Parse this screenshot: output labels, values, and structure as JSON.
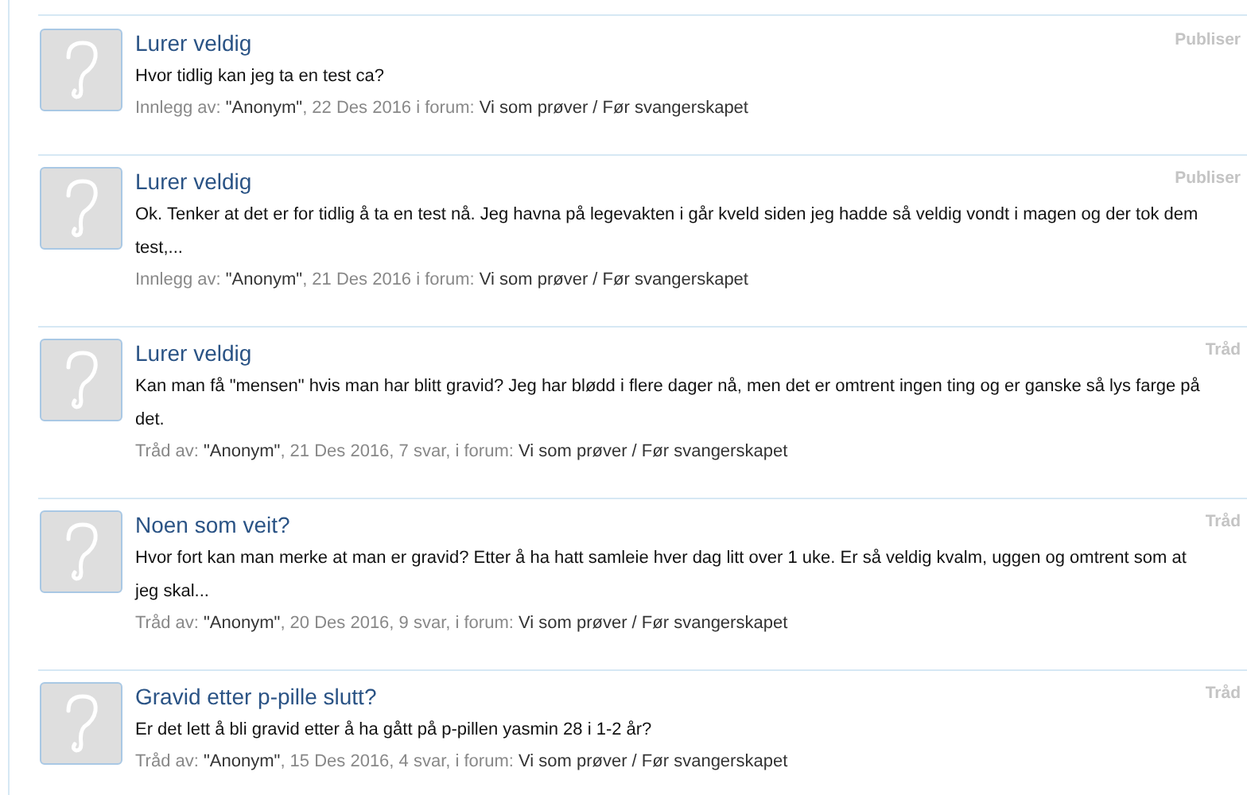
{
  "posts": [
    {
      "title": "Lurer veldig",
      "type": "Publiser",
      "body": "Hvor tidlig kan jeg ta en test ca?",
      "meta": {
        "label": "Innlegg av:",
        "author": "\"Anonym\"",
        "details": ", 22 Des 2016 i forum:",
        "forum": "Vi som prøver / Før svangerskapet"
      }
    },
    {
      "title": "Lurer veldig",
      "type": "Publiser",
      "body": "Ok. Tenker at det er for tidlig å ta en test nå. Jeg havna på legevakten i går kveld siden jeg hadde så veldig vondt i magen og der tok dem test,...",
      "meta": {
        "label": "Innlegg av:",
        "author": "\"Anonym\"",
        "details": ", 21 Des 2016 i forum:",
        "forum": "Vi som prøver / Før svangerskapet"
      }
    },
    {
      "title": "Lurer veldig",
      "type": "Tråd",
      "body": "Kan man få \"mensen\" hvis man har blitt gravid? Jeg har blødd i flere dager nå, men det er omtrent ingen ting og er ganske så lys farge på det.",
      "meta": {
        "label": "Tråd av:",
        "author": "\"Anonym\"",
        "details": ", 21 Des 2016, 7 svar, i forum:",
        "forum": "Vi som prøver / Før svangerskapet"
      }
    },
    {
      "title": "Noen som veit?",
      "type": "Tråd",
      "body": "Hvor fort kan man merke at man er gravid? Etter å ha hatt samleie hver dag litt over 1 uke. Er så veldig kvalm, uggen og omtrent som at jeg skal...",
      "meta": {
        "label": "Tråd av:",
        "author": "\"Anonym\"",
        "details": ", 20 Des 2016, 9 svar, i forum:",
        "forum": "Vi som prøver / Før svangerskapet"
      }
    },
    {
      "title": "Gravid etter p-pille slutt?",
      "type": "Tråd",
      "body": "Er det lett å bli gravid etter å ha gått på p-pillen yasmin 28 i 1-2 år?",
      "meta": {
        "label": "Tråd av:",
        "author": "\"Anonym\"",
        "details": ", 15 Des 2016, 4 svar, i forum:",
        "forum": "Vi som prøver / Før svangerskapet"
      }
    }
  ]
}
